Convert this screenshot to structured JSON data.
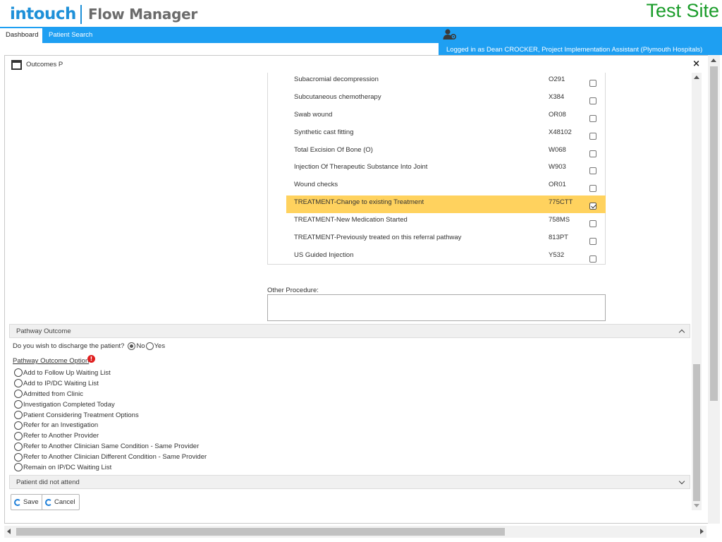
{
  "header": {
    "logo_intouch": "intouch",
    "logo_product": "Flow Manager",
    "site_label": "Test Site"
  },
  "nav": {
    "tabs": [
      {
        "label": "Dashboard"
      },
      {
        "label": "Patient Search"
      }
    ],
    "logged_in": "Logged in as Dean CROCKER, Project Implementation Assistant (Plymouth Hospitals)"
  },
  "dialog": {
    "title": "Outcomes P",
    "close": "×"
  },
  "procedures": [
    {
      "name": "Subacromial decompression",
      "code": "O291",
      "checked": false
    },
    {
      "name": "Subcutaneous chemotherapy",
      "code": "X384",
      "checked": false
    },
    {
      "name": "Swab wound",
      "code": "OR08",
      "checked": false
    },
    {
      "name": "Synthetic cast fitting",
      "code": "X48102",
      "checked": false
    },
    {
      "name": "Total Excision Of Bone (O)",
      "code": "W068",
      "checked": false
    },
    {
      "name": "Injection Of Therapeutic Substance Into Joint",
      "code": "W903",
      "checked": false
    },
    {
      "name": "Wound checks",
      "code": "OR01",
      "checked": false
    },
    {
      "name": "TREATMENT-Change to existing Treatment",
      "code": "775CTT",
      "checked": true
    },
    {
      "name": "TREATMENT-New Medication Started",
      "code": "758MS",
      "checked": false
    },
    {
      "name": "TREATMENT-Previously treated on this referral pathway",
      "code": "813PT",
      "checked": false
    },
    {
      "name": "US Guided Injection",
      "code": "Y532",
      "checked": false
    }
  ],
  "other_procedure": {
    "label": "Other Procedure:",
    "value": ""
  },
  "pathway_outcome": {
    "header": "Pathway Outcome",
    "discharge_question": "Do you wish to discharge the patient?",
    "discharge_no": "No",
    "discharge_yes": "Yes",
    "discharge_selected": "No",
    "option_title": "Pathway Outcome Option",
    "warning": "!",
    "options": [
      "Add to Follow Up Waiting List",
      "Add to IP/DC Waiting List",
      "Admitted from Clinic",
      "Investigation Completed Today",
      "Patient Considering Treatment Options",
      "Refer for an Investigation",
      "Refer to Another Provider",
      "Refer to Another Clinician Same Condition - Same Provider",
      "Refer to Another Clinician Different Condition - Same Provider",
      "Remain on IP/DC Waiting List"
    ]
  },
  "dna": {
    "header": "Patient did not attend"
  },
  "buttons": {
    "save": "Save",
    "cancel": "Cancel"
  },
  "colors": {
    "brand_blue": "#1e9ff2",
    "highlight": "#ffd25e",
    "test_site": "#1a9c2a",
    "warning": "#e02020"
  }
}
